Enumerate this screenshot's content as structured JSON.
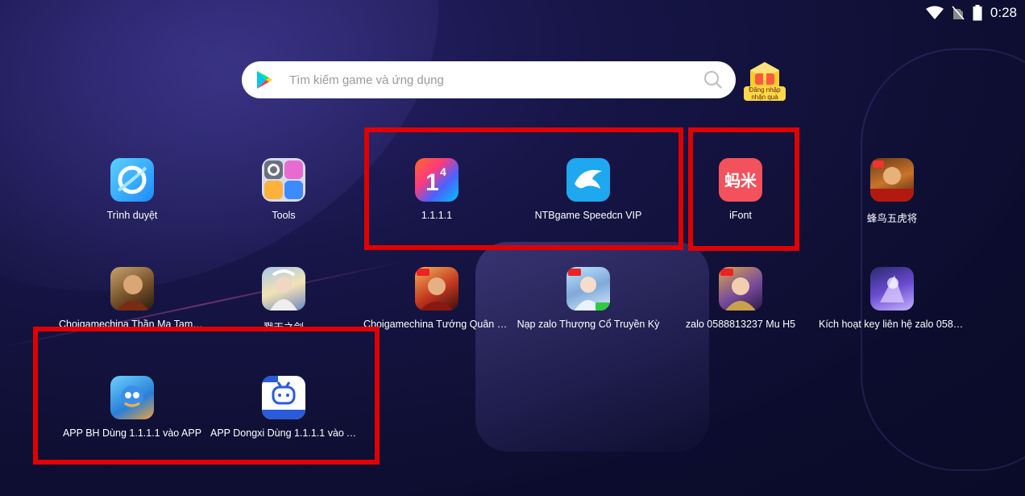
{
  "status_bar": {
    "time": "0:28"
  },
  "search": {
    "placeholder": "Tìm kiếm game và ứng dụng"
  },
  "reward_badge": {
    "label": "Đăng nhập nhận quà"
  },
  "apps": [
    {
      "label": "Trình duyệt",
      "icon": "browser-icon"
    },
    {
      "label": "Tools",
      "icon": "tools-folder-icon"
    },
    {
      "label": "1.1.1.1",
      "icon": "warp-1111-icon"
    },
    {
      "label": "NTBgame Speedcn VIP",
      "icon": "dolphin-icon"
    },
    {
      "label": "iFont",
      "icon": "ifont-icon"
    },
    {
      "label": "蜂鸟五虎将",
      "icon": "game-warriors-icon"
    },
    {
      "label": "Choigamechina Thần Ma Tam Q…",
      "icon": "game-three-kingdoms-icon"
    },
    {
      "label": "戮天之剑",
      "icon": "game-sword-icon"
    },
    {
      "label": "Choigamechina Tướng Quân Dừ…",
      "icon": "game-general-icon"
    },
    {
      "label": "Nạp zalo Thượng Cổ Truyền Kỳ",
      "icon": "game-legend-icon"
    },
    {
      "label": "zalo 0588813237 Mu H5",
      "icon": "game-mu-icon"
    },
    {
      "label": "Kích hoạt key liên hệ zalo 05888…",
      "icon": "game-key-icon"
    },
    {
      "label": "APP BH Dùng 1.1.1.1 vào APP",
      "icon": "app-bh-icon"
    },
    {
      "label": "APP Dongxi Dùng 1.1.1.1 vào A…",
      "icon": "app-dongxi-icon"
    }
  ],
  "colors": {
    "highlight": "#e00000",
    "background": "#12123e"
  }
}
